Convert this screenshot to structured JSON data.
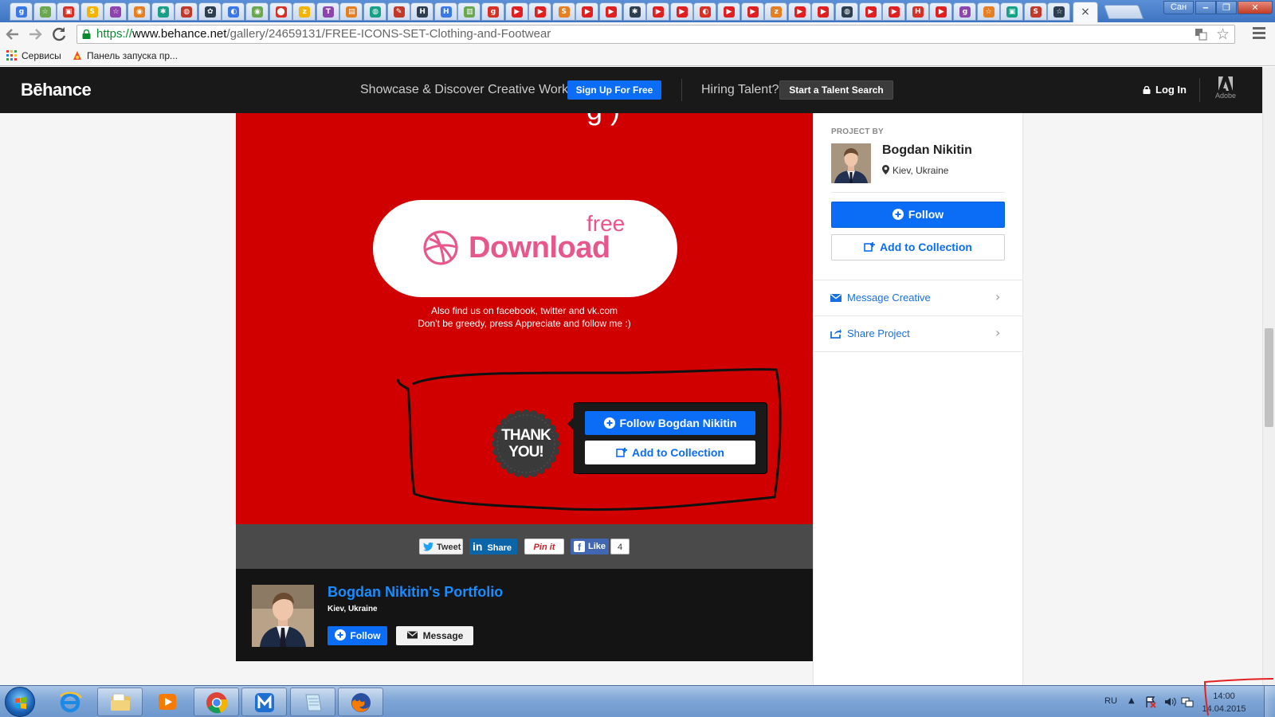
{
  "browser": {
    "tab_close_glyph": "×",
    "window_user": "Сан",
    "window_buttons": {
      "minimize": "‒",
      "maximize": "❐",
      "close": "✕"
    },
    "url": {
      "scheme": "https://",
      "host": "www.behance.net",
      "path": "/gallery/24659131/FREE-ICONS-SET-Clothing-and-Footwear"
    },
    "bookmarks": [
      {
        "label": "Сервисы",
        "icon": "apps-grid-icon"
      },
      {
        "label": "Панель запуска пр...",
        "icon": "app-launcher-icon"
      }
    ]
  },
  "behance": {
    "logo": "Bēhance",
    "tagline": "Showcase & Discover Creative Work",
    "signup_label": "Sign Up For Free",
    "hiring_text": "Hiring Talent?",
    "talent_search_label": "Start a Talent Search",
    "login_label": "Log In",
    "adobe_label": "Adobe",
    "accent_color": "#0b6cf5"
  },
  "project": {
    "title_fragment": "g )",
    "download_word": "Download",
    "free_word": "free",
    "find_line_1": "Also find us on facebook, twitter and vk.com",
    "find_line_2": "Don't be greedy, press Appreciate and follow me :)",
    "thank_line_1": "THANK",
    "thank_line_2": "YOU!",
    "cta_follow_label": "Follow Bogdan Nikitin",
    "cta_collection_label": "Add to Collection",
    "panel_color": "#d00000"
  },
  "share": {
    "tweet_label": "Tweet",
    "linkedin_label": "Share",
    "pinterest_label": "Pin it",
    "facebook_label": "Like",
    "facebook_count": "4"
  },
  "owner": {
    "portfolio_title": "Bogdan Nikitin's Portfolio",
    "location": "Kiev, Ukraine",
    "follow_label": "Follow",
    "message_label": "Message"
  },
  "sidebar": {
    "project_by_label": "PROJECT BY",
    "name": "Bogdan Nikitin",
    "location": "Kiev, Ukraine",
    "follow_label": "Follow",
    "collection_label": "Add to Collection",
    "message_label": "Message Creative",
    "share_label": "Share Project"
  },
  "taskbar": {
    "apps": [
      "internet-explorer",
      "file-explorer",
      "media-player",
      "chrome",
      "maxthon",
      "notepad",
      "firefox"
    ],
    "language": "RU",
    "time": "14:00",
    "date": "14.04.2015"
  }
}
